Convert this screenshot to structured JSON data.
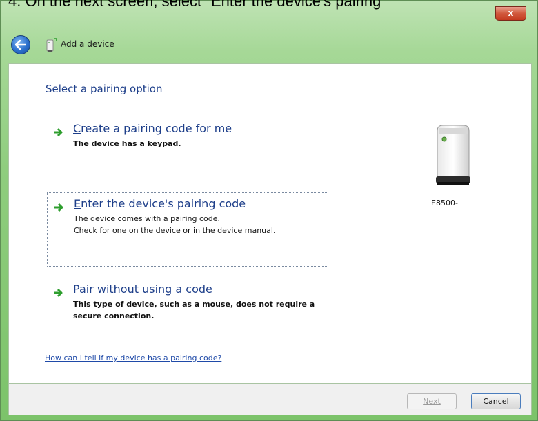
{
  "caption": "4. On the next screen, select \"Enter the device's pairing",
  "window": {
    "title": "Add a device",
    "close_glyph": "x"
  },
  "content": {
    "heading": "Select a pairing option",
    "options": [
      {
        "title_prefix": "",
        "mnemonic": "C",
        "title_rest": "reate a pairing code for me",
        "desc": [
          "The device has a keypad."
        ]
      },
      {
        "mnemonic": "E",
        "title_rest": "nter the device's pairing code",
        "desc": [
          "The device comes with a pairing code.",
          "Check for one on the device or in the device manual."
        ]
      },
      {
        "mnemonic": "P",
        "title_rest": "air without using a code",
        "desc": [
          "This type of device, such as a mouse, does not require a",
          "secure connection."
        ]
      }
    ],
    "help_link": "How can I tell if my device has a pairing code?",
    "device_label": "E8500-"
  },
  "footer": {
    "next_label": "Next",
    "cancel_label": "Cancel"
  },
  "icons": {
    "back": "back-arrow-icon",
    "device_small": "add-device-icon",
    "option_arrow": "green-arrow-icon",
    "device": "router-icon"
  },
  "colors": {
    "link_blue": "#1e3f8a",
    "chrome_green": "#8fcd7e",
    "arrow_green": "#2e9e2e",
    "close_red": "#c43a1f"
  }
}
